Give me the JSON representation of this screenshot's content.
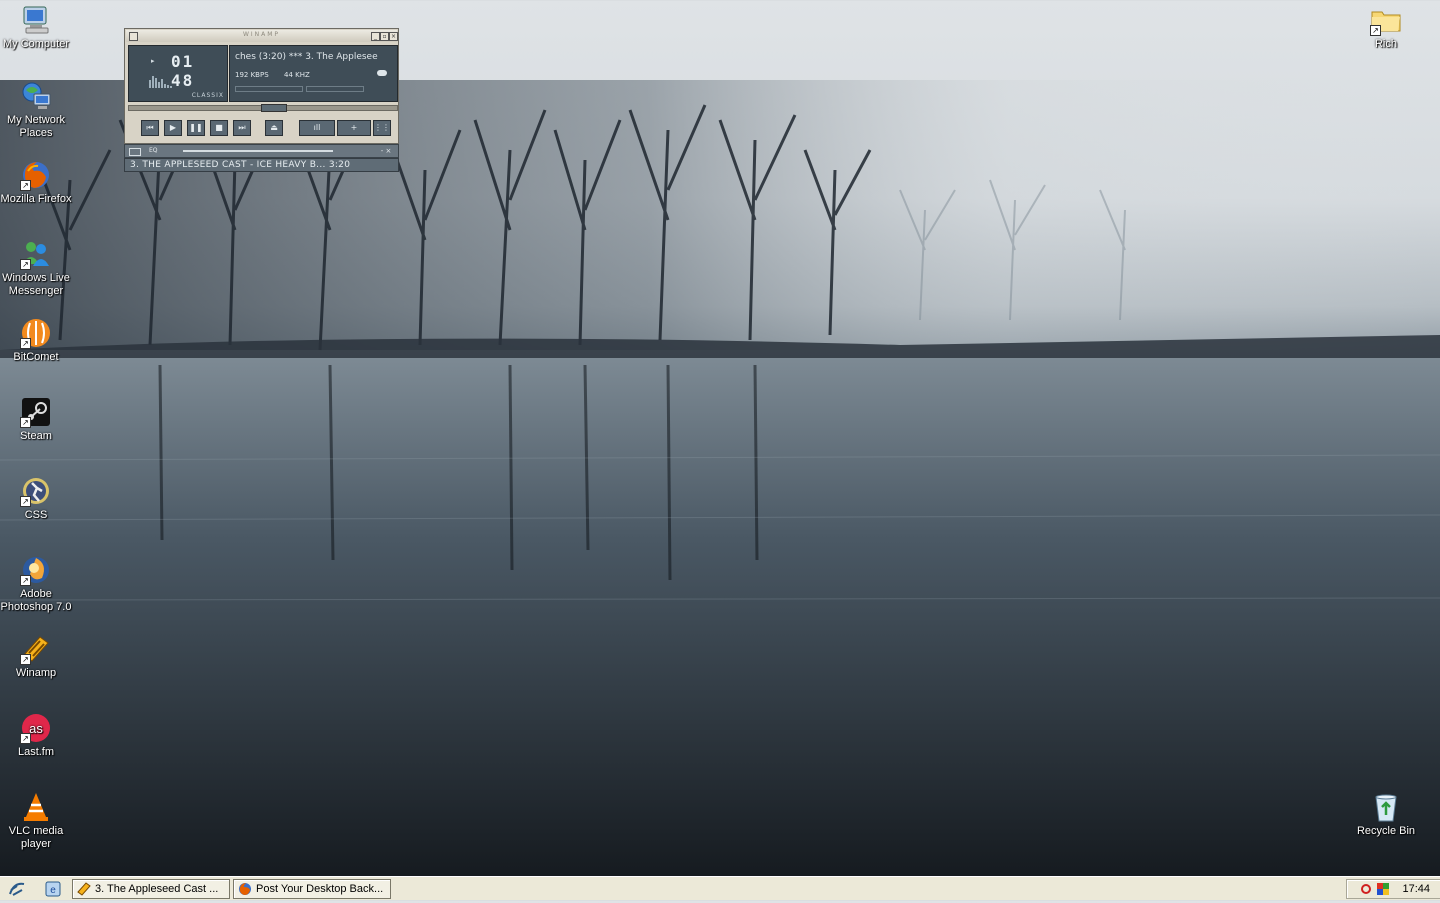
{
  "desktop": {
    "left_icons": [
      {
        "label": "My Computer",
        "icon": "computer-icon"
      },
      {
        "label": "My Network Places",
        "icon": "network-icon"
      },
      {
        "label": "Mozilla Firefox",
        "icon": "firefox-icon"
      },
      {
        "label": "Windows Live Messenger",
        "icon": "messenger-icon"
      },
      {
        "label": "BitComet",
        "icon": "bitcomet-icon"
      },
      {
        "label": "Steam",
        "icon": "steam-icon"
      },
      {
        "label": "CSS",
        "icon": "css-icon"
      },
      {
        "label": "Adobe Photoshop 7.0",
        "icon": "photoshop-icon"
      },
      {
        "label": "Winamp",
        "icon": "winamp-icon"
      },
      {
        "label": "Last.fm",
        "icon": "lastfm-icon"
      },
      {
        "label": "VLC media player",
        "icon": "vlc-icon"
      }
    ],
    "right_icons": [
      {
        "label": "Rich",
        "icon": "folder-icon"
      },
      {
        "label": "Recycle Bin",
        "icon": "recycle-bin-icon"
      }
    ]
  },
  "winamp": {
    "title": "WINAMP",
    "time": "01 48",
    "marquee": "ches (3:20) *** 3. The Applesee",
    "kbps": "192 KBPS",
    "khz": "44 KHZ",
    "skin_label": "CLASSIX",
    "eq_label": "EQ",
    "playlist_entry": "3. THE APPLESEED CAST - ICE HEAVY B... 3:20",
    "seek_fraction": 0.54
  },
  "taskbar": {
    "tasks": [
      {
        "label": "3. The Appleseed Cast ...",
        "icon": "winamp-icon"
      },
      {
        "label": "Post Your Desktop Back...",
        "icon": "firefox-icon"
      }
    ],
    "clock": "17:44"
  },
  "colors": {
    "taskbar_bg": "#ece9d8",
    "winamp_display": "#3f4d57"
  }
}
